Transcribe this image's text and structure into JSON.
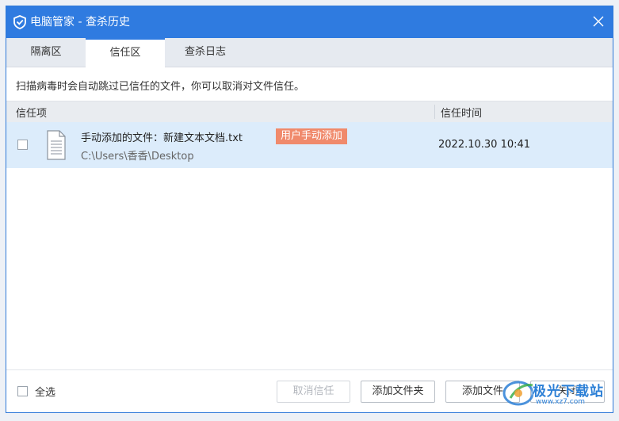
{
  "window": {
    "title": "电脑管家 - 查杀历史",
    "accent": "#2f7be0"
  },
  "tabs": [
    {
      "label": "隔离区",
      "active": false
    },
    {
      "label": "信任区",
      "active": true
    },
    {
      "label": "查杀日志",
      "active": false
    }
  ],
  "info_text": "扫描病毒时会自动跳过已信任的文件，你可以取消对文件信任。",
  "table": {
    "columns": [
      "信任项",
      "信任时间"
    ],
    "rows": [
      {
        "name": "手动添加的文件：新建文本文档.txt",
        "tag": "用户手动添加",
        "path": "C:\\Users\\香香\\Desktop",
        "time": "2022.10.30 10:41",
        "checked": false
      }
    ]
  },
  "footer": {
    "select_all_label": "全选",
    "buttons": {
      "cancel_trust": "取消信任",
      "add_folder": "添加文件夹",
      "add_file": "添加文件",
      "close": "关闭"
    }
  },
  "watermark": {
    "text": "极光下载站",
    "url": "www.xz7.com"
  },
  "colors": {
    "titlebar": "#2f7be0",
    "selected_row": "#dcecfb",
    "badge": "#f08a6c"
  }
}
